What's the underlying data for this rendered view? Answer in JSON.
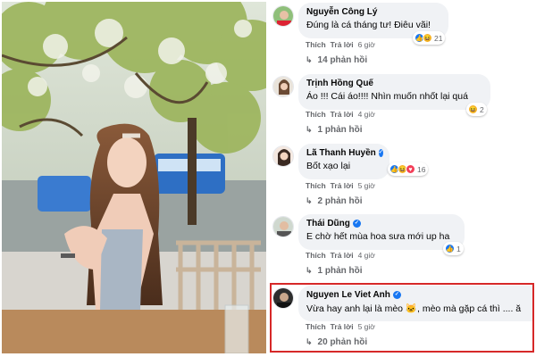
{
  "comments": [
    {
      "name": "Nguyễn Công Lý",
      "verified": false,
      "text": "Đúng là cá tháng tư! Điêu vãi!",
      "reaction_icons": [
        "like-icon",
        "haha-icon"
      ],
      "reaction_count": "21",
      "like_label": "Thích",
      "reply_label": "Trả lời",
      "time": "6 giờ",
      "replies": "14 phản hồi"
    },
    {
      "name": "Trịnh Hồng Quế",
      "verified": false,
      "text": "Áo !!! Cái áo!!!! Nhìn muốn nhốt lại quá",
      "reaction_icons": [
        "haha-icon"
      ],
      "reaction_count": "2",
      "like_label": "Thích",
      "reply_label": "Trả lời",
      "time": "4 giờ",
      "replies": "1 phản hồi"
    },
    {
      "name": "Lã Thanh Huyền",
      "verified": true,
      "text": "Bốt xạo lại",
      "reaction_icons": [
        "like-icon",
        "haha-icon",
        "love-icon"
      ],
      "reaction_count": "16",
      "like_label": "Thích",
      "reply_label": "Trả lời",
      "time": "5 giờ",
      "replies": "2 phản hồi"
    },
    {
      "name": "Thái Dũng",
      "verified": true,
      "text": "E chờ hết mùa hoa sưa mới up ha",
      "reaction_icons": [
        "like-icon"
      ],
      "reaction_count": "1",
      "like_label": "Thích",
      "reply_label": "Trả lời",
      "time": "4 giờ",
      "replies": "1 phản hồi"
    },
    {
      "name": "Nguyen Le Viet Anh",
      "verified": true,
      "text": "Vừa hay anh lại là mèo 🐱, mèo mà gặp cá thì .... ă",
      "reaction_icons": [],
      "reaction_count": "",
      "like_label": "Thích",
      "reply_label": "Trả lời",
      "time": "5 giờ",
      "replies": "20 phản hồi"
    }
  ],
  "colors": {
    "bubble": "#f0f2f5",
    "meta_text": "#65676b",
    "verified": "#1877f2",
    "highlight": "#d62828"
  }
}
